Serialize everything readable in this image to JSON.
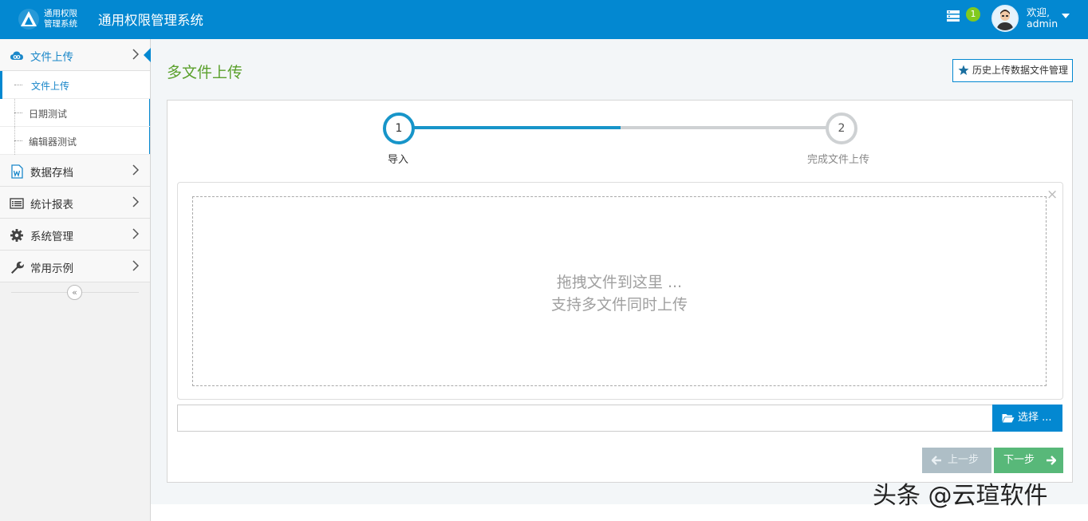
{
  "header": {
    "logo_text_line1": "通用权限",
    "logo_text_line2": "管理系统",
    "app_title": "通用权限管理系统",
    "message_count": "1",
    "welcome_line1": "欢迎,",
    "welcome_line2": "admin"
  },
  "sidebar": {
    "items": [
      {
        "label": "文件上传",
        "icon": "cloud-icon"
      },
      {
        "label": "数据存档",
        "icon": "word-doc-icon"
      },
      {
        "label": "统计报表",
        "icon": "list-icon"
      },
      {
        "label": "系统管理",
        "icon": "gear-icon"
      },
      {
        "label": "常用示例",
        "icon": "wrench-icon"
      }
    ],
    "submenu": [
      {
        "label": "文件上传"
      },
      {
        "label": "日期测试"
      },
      {
        "label": "编辑器测试"
      }
    ],
    "collapse_glyph": "«"
  },
  "main": {
    "page_title": "多文件上传",
    "history_button": "历史上传数据文件管理",
    "steps": [
      {
        "number": "1",
        "label": "导入"
      },
      {
        "number": "2",
        "label": "完成文件上传"
      }
    ],
    "progress": 0.5,
    "dropzone_line1": "拖拽文件到这里 ...",
    "dropzone_line2": "支持多文件同时上传",
    "browse_button": "选择 ...",
    "prev_button": "上一步",
    "next_button": "下一步"
  },
  "watermark": "头条 @云瑄软件",
  "colors": {
    "primary": "#0388d1",
    "title_green": "#5aa02c",
    "next_green": "#58b879",
    "prev_disabled": "#aebec6",
    "badge_green": "#82c91e"
  }
}
